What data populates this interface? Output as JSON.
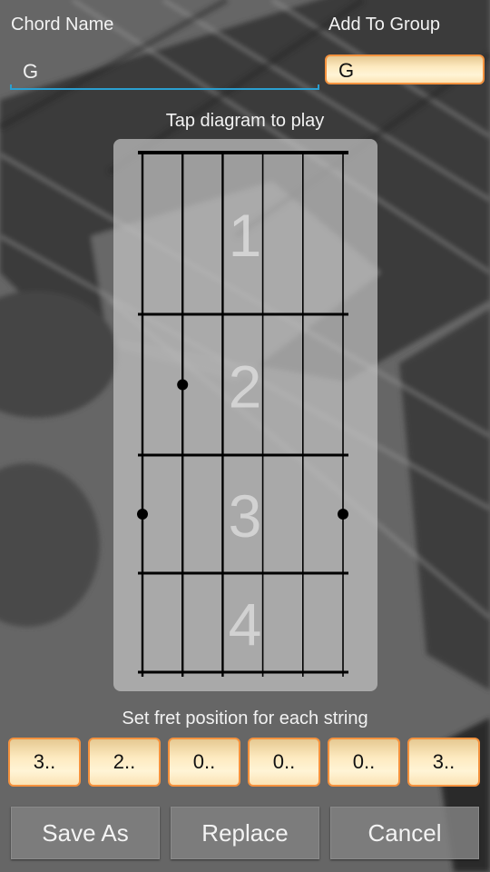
{
  "header": {
    "chord_name_label": "Chord Name",
    "chord_name_value": "G",
    "add_to_group_label": "Add To Group",
    "group_value": "G"
  },
  "diagram": {
    "hint": "Tap diagram to play",
    "fret_numbers": [
      "1",
      "2",
      "3",
      "4"
    ],
    "string_count": 6,
    "fret_count": 4,
    "dots": [
      {
        "string": 1,
        "fret": 3
      },
      {
        "string": 2,
        "fret": 2
      },
      {
        "string": 6,
        "fret": 3
      }
    ]
  },
  "fret_positions": {
    "hint": "Set fret position for each string",
    "values": [
      "3..",
      "2..",
      "0..",
      "0..",
      "0..",
      "3.."
    ]
  },
  "actions": {
    "save_as": "Save As",
    "replace": "Replace",
    "cancel": "Cancel"
  },
  "colors": {
    "accent_underline": "#2b9fd0",
    "orange_border": "#f5923e"
  }
}
